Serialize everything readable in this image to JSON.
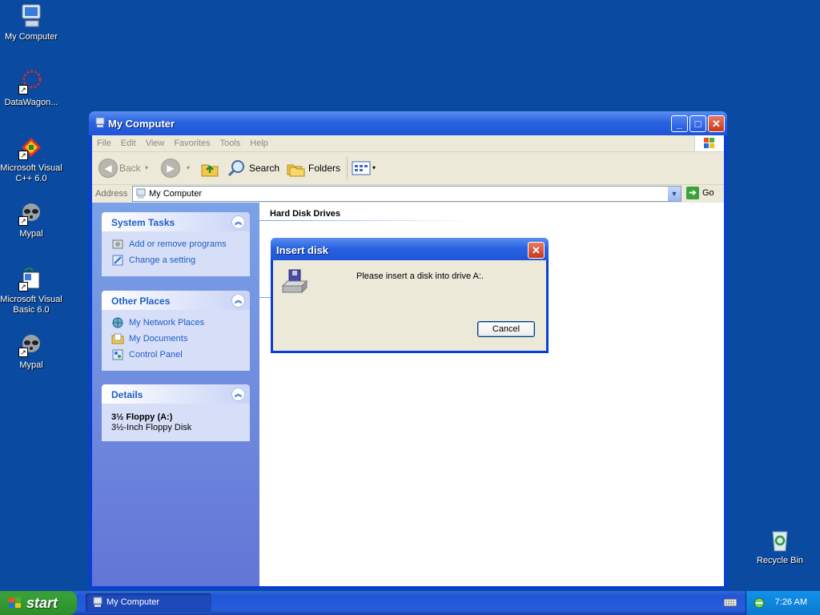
{
  "desktop": {
    "icons": [
      {
        "label": "My Computer"
      },
      {
        "label": "DataWagon..."
      },
      {
        "label": "Microsoft Visual C++ 6.0"
      },
      {
        "label": "Mypal"
      },
      {
        "label": "Microsoft Visual Basic 6.0"
      },
      {
        "label": "Mypal"
      },
      {
        "label": "Recycle Bin"
      }
    ]
  },
  "window": {
    "title": "My Computer",
    "menu": [
      "File",
      "Edit",
      "View",
      "Favorites",
      "Tools",
      "Help"
    ],
    "toolbar": {
      "back": "Back",
      "search": "Search",
      "folders": "Folders"
    },
    "address": {
      "label": "Address",
      "value": "My Computer",
      "go": "Go"
    },
    "taskpane": {
      "system_tasks": {
        "title": "System Tasks",
        "links": [
          "Add or remove programs",
          "Change a setting"
        ]
      },
      "other_places": {
        "title": "Other Places",
        "links": [
          "My Network Places",
          "My Documents",
          "Control Panel"
        ]
      },
      "details": {
        "title": "Details",
        "name": "3½ Floppy (A:)",
        "type": "3½-Inch Floppy Disk"
      }
    },
    "content": {
      "section_header": "Hard Disk Drives"
    }
  },
  "dialog": {
    "title": "Insert disk",
    "message": "Please insert a disk into drive A:.",
    "cancel": "Cancel"
  },
  "taskbar": {
    "start": "start",
    "task_item": "My Computer",
    "clock": "7:26 AM"
  },
  "colors": {
    "desktop": "#0a4aa0",
    "titlebar": "#2a63e0",
    "link": "#215dc6",
    "start_green": "#37a036"
  }
}
